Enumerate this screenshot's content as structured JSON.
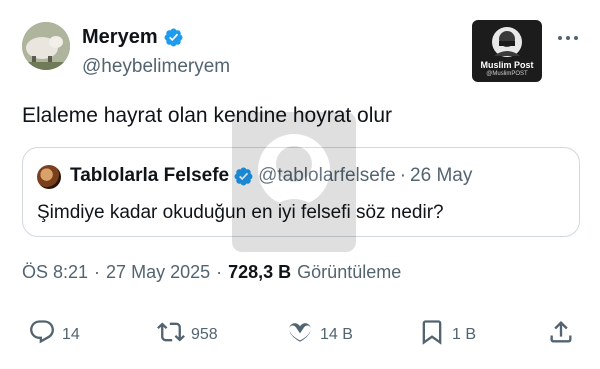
{
  "author": {
    "display_name": "Meryem",
    "handle": "@heybelimeryem"
  },
  "badge": {
    "line1": "Muslim Post",
    "line2": "@MuslimPOST"
  },
  "tweet_text": "Elaleme hayrat olan kendine hoyrat olur",
  "quoted": {
    "display_name": "Tablolarla Felsefe",
    "handle": "@tablolarfelsefe",
    "separator": "·",
    "date": "26 May",
    "text": "Şimdiye kadar okuduğun en iyi felsefi söz nedir?"
  },
  "meta": {
    "time": "ÖS 8:21",
    "separator": "·",
    "date": "27 May 2025",
    "separator2": "·",
    "views_count": "728,3 B",
    "views_label": "Görüntüleme"
  },
  "actions": {
    "replies": "14",
    "reposts": "958",
    "likes": "14 B",
    "bookmarks": "1 B"
  },
  "colors": {
    "verified": "#1d9bf0",
    "text": "#0f1419",
    "secondary": "#536471",
    "border": "#cfd9de"
  },
  "icons": [
    "verified-icon",
    "more-icon",
    "reply-icon",
    "repost-icon",
    "like-icon",
    "bookmark-icon",
    "share-icon"
  ]
}
